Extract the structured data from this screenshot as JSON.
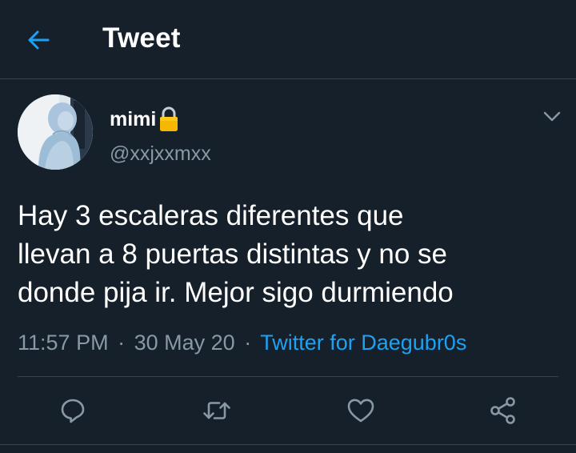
{
  "header": {
    "title": "Tweet",
    "back_icon": "arrow-left-icon"
  },
  "author": {
    "display_name": "mimi",
    "protected_icon": "lock-icon",
    "handle": "@xxjxxmxx"
  },
  "tweet": {
    "text_lines": [
      "Hay 3 escaleras diferentes que",
      "llevan a 8 puertas distintas y no se",
      "donde pija ir. Mejor sigo durmiendo"
    ],
    "time": "11:57 PM",
    "separator": "·",
    "date": "30 May 20",
    "source": "Twitter for Daegubr0s"
  },
  "actions": {
    "reply_icon": "reply-icon",
    "retweet_icon": "retweet-icon",
    "like_icon": "heart-icon",
    "share_icon": "share-icon"
  },
  "colors": {
    "background": "#15202b",
    "accent": "#1da1f2",
    "secondary_text": "#8899a6",
    "divider": "#38444d",
    "lock": "#f5b700"
  }
}
